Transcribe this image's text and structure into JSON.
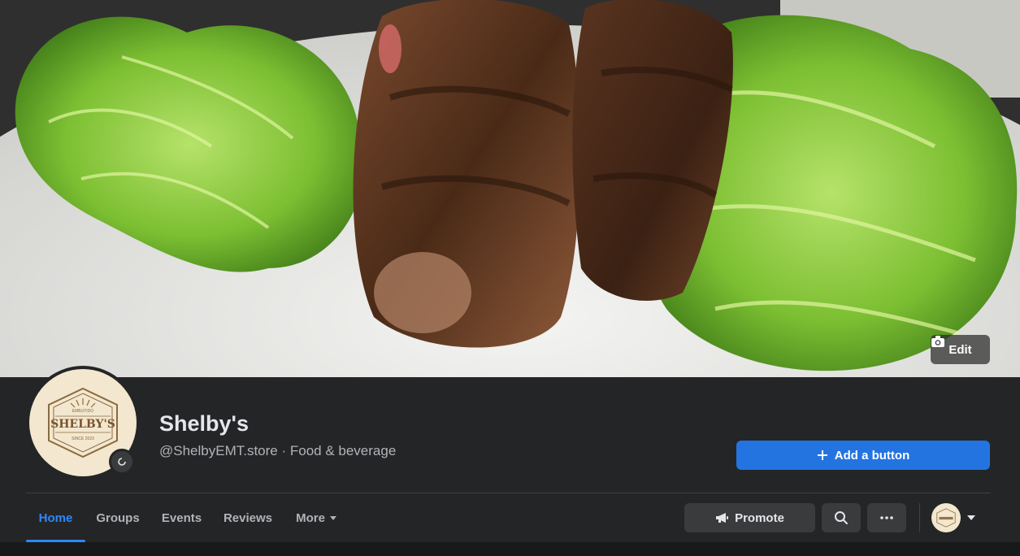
{
  "cover": {
    "edit_label": "Edit"
  },
  "profile": {
    "name": "Shelby's",
    "subtitle": "@ShelbyEMT.store · Food & beverage",
    "logo_top": "EMBUTIDO",
    "logo_name": "SHELBY'S",
    "logo_bottom": "SINCE 2023"
  },
  "actions": {
    "add_button": "Add a button",
    "promote": "Promote"
  },
  "tabs": [
    {
      "label": "Home",
      "active": true
    },
    {
      "label": "Groups",
      "active": false
    },
    {
      "label": "Events",
      "active": false
    },
    {
      "label": "Reviews",
      "active": false
    },
    {
      "label": "More",
      "active": false
    }
  ],
  "icons": {
    "camera": "camera-icon",
    "plus": "plus-icon",
    "megaphone": "megaphone-icon",
    "search": "search-icon",
    "more": "ellipsis-icon",
    "caret": "caret-down-icon"
  },
  "colors": {
    "accent": "#2d88ff",
    "button_primary": "#2374e1",
    "surface": "#242526",
    "button_secondary": "#3a3b3c"
  }
}
